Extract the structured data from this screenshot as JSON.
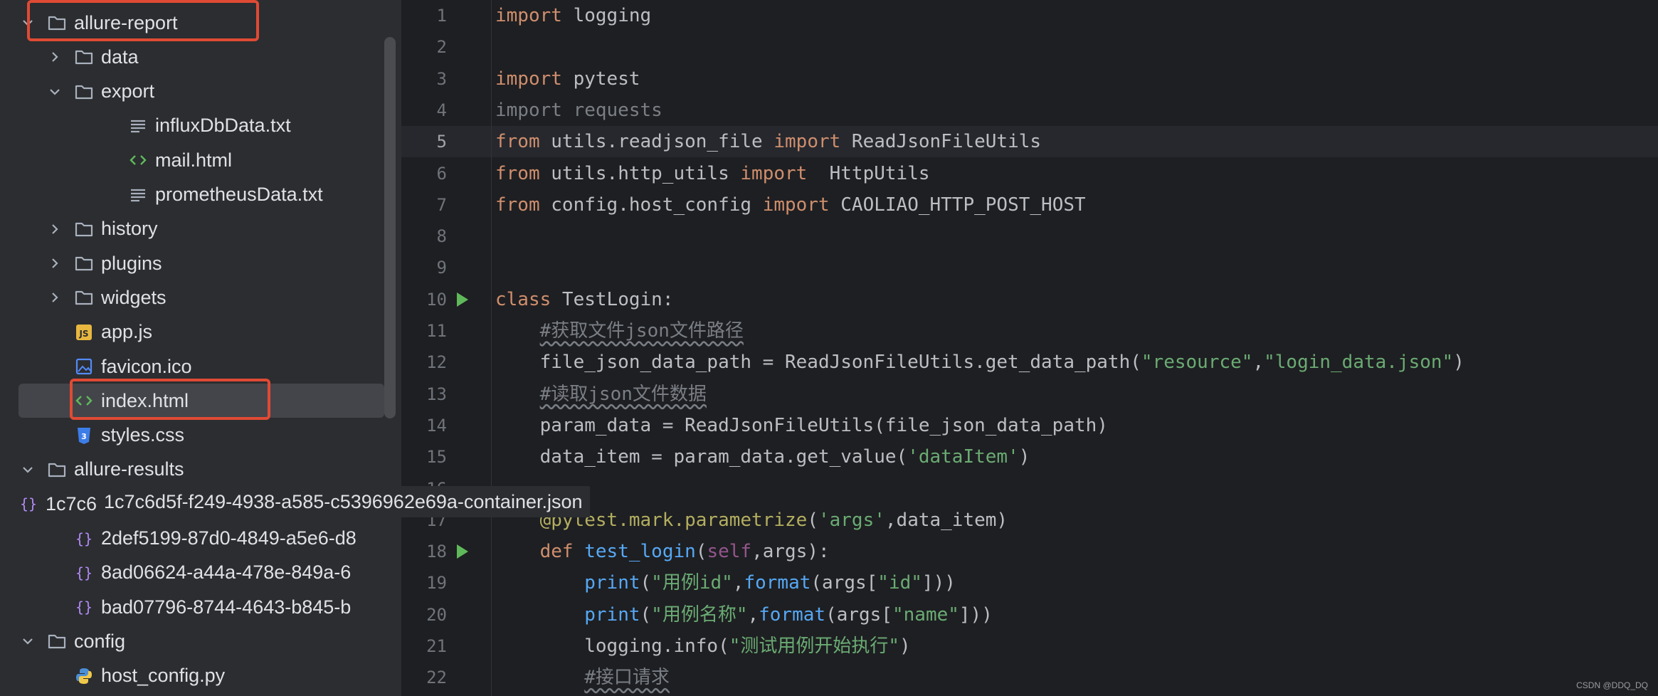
{
  "project_tree": {
    "rows": [
      {
        "label": "allure-report",
        "icon": "folder-icon",
        "chevron": "down",
        "level": 1
      },
      {
        "label": "data",
        "icon": "folder-icon",
        "chevron": "right",
        "level": 2
      },
      {
        "label": "export",
        "icon": "folder-icon",
        "chevron": "down",
        "level": 2
      },
      {
        "label": "influxDbData.txt",
        "icon": "text-file-icon",
        "chevron": "",
        "level": 3
      },
      {
        "label": "mail.html",
        "icon": "html-file-icon",
        "chevron": "",
        "level": 3
      },
      {
        "label": "prometheusData.txt",
        "icon": "text-file-icon",
        "chevron": "",
        "level": 3
      },
      {
        "label": "history",
        "icon": "folder-icon",
        "chevron": "right",
        "level": 2
      },
      {
        "label": "plugins",
        "icon": "folder-icon",
        "chevron": "right",
        "level": 2
      },
      {
        "label": "widgets",
        "icon": "folder-icon",
        "chevron": "right",
        "level": 2
      },
      {
        "label": "app.js",
        "icon": "js-file-icon",
        "chevron": "",
        "level": 2
      },
      {
        "label": "favicon.ico",
        "icon": "image-file-icon",
        "chevron": "",
        "level": 2
      },
      {
        "label": "index.html",
        "icon": "html-file-icon",
        "chevron": "",
        "level": 2
      },
      {
        "label": "styles.css",
        "icon": "css-file-icon",
        "chevron": "",
        "level": 2
      },
      {
        "label": "allure-results",
        "icon": "folder-icon",
        "chevron": "down",
        "level": 1
      },
      {
        "label": "1c7c6d5f-f249-4938-a585-c5396962e69a-container.json",
        "icon": "json-file-icon",
        "chevron": "",
        "level": 2
      },
      {
        "label": "2def5199-87d0-4849-a5e6-d8",
        "icon": "json-file-icon",
        "chevron": "",
        "level": 2
      },
      {
        "label": "8ad06624-a44a-478e-849a-6",
        "icon": "json-file-icon",
        "chevron": "",
        "level": 2
      },
      {
        "label": "bad07796-8744-4643-b845-b",
        "icon": "json-file-icon",
        "chevron": "",
        "level": 2
      },
      {
        "label": "config",
        "icon": "folder-icon",
        "chevron": "down",
        "level": 1
      },
      {
        "label": "host_config.py",
        "icon": "python-file-icon",
        "chevron": "",
        "level": 2
      }
    ],
    "selected_label": "index.html",
    "tooltip": "1c7c6d5f-f249-4938-a585-c5396962e69a-container.json"
  },
  "editor": {
    "current_line": 5,
    "lines": [
      {
        "n": "1",
        "html": "<span class='kw'>import</span> logging"
      },
      {
        "n": "2",
        "html": ""
      },
      {
        "n": "3",
        "html": "<span class='kw'>import</span> pytest"
      },
      {
        "n": "4",
        "html": "<span class='dim'>import requests</span>"
      },
      {
        "n": "5",
        "html": "<span class='kw'>from</span> utils.readjson_file <span class='kw'>import</span> ReadJsonFileUtils"
      },
      {
        "n": "6",
        "html": "<span class='kw'>from</span> utils.http_utils <span class='kw'>import</span>  HttpUtils"
      },
      {
        "n": "7",
        "html": "<span class='kw'>from</span> config.host_config <span class='kw'>import</span> CAOLIAO_HTTP_POST_HOST"
      },
      {
        "n": "8",
        "html": ""
      },
      {
        "n": "9",
        "html": ""
      },
      {
        "n": "10",
        "html": "<span class='kw'>class</span> TestLogin:",
        "run": true
      },
      {
        "n": "11",
        "html": "    <span class='cmt'>#获取文件json文件路径</span>"
      },
      {
        "n": "12",
        "html": "    file_json_data_path = ReadJsonFileUtils.get_data_path(<span class='str'>\"resource\"</span>,<span class='str'>\"login_data.json\"</span>)"
      },
      {
        "n": "13",
        "html": "    <span class='cmt'>#读取json文件数据</span>"
      },
      {
        "n": "14",
        "html": "    param_data = ReadJsonFileUtils(file_json_data_path)"
      },
      {
        "n": "15",
        "html": "    data_item = param_data.get_value(<span class='str'>'dataItem'</span>)"
      },
      {
        "n": "16",
        "html": ""
      },
      {
        "n": "17",
        "html": "    <span style='color:#b3ae60'>@pytest.mark.parametrize</span>(<span class='str'>'args'</span>,data_item)"
      },
      {
        "n": "18",
        "html": "    <span class='kw'>def</span> <span class='fn'>test_login</span>(<span class='self'>self</span>,args):",
        "run": true
      },
      {
        "n": "19",
        "html": "        <span class='bi'>print</span>(<span class='str'>\"用例id\"</span>,<span class='bi'>format</span>(args[<span class='str'>\"id\"</span>]))"
      },
      {
        "n": "20",
        "html": "        <span class='bi'>print</span>(<span class='str'>\"用例名称\"</span>,<span class='bi'>format</span>(args[<span class='str'>\"name\"</span>]))"
      },
      {
        "n": "21",
        "html": "        logging.info(<span class='str'>\"测试用例开始执行\"</span>)"
      },
      {
        "n": "22",
        "html": "        <span class='cmt'>#接口请求</span>"
      }
    ]
  },
  "watermark": "CSDN @DDQ_DQ",
  "colors": {
    "highlight_box": "#e04a34",
    "folder": "#a9b1bd",
    "html": "#5fb95b",
    "css": "#3d7de8",
    "js": "#e8b740"
  }
}
